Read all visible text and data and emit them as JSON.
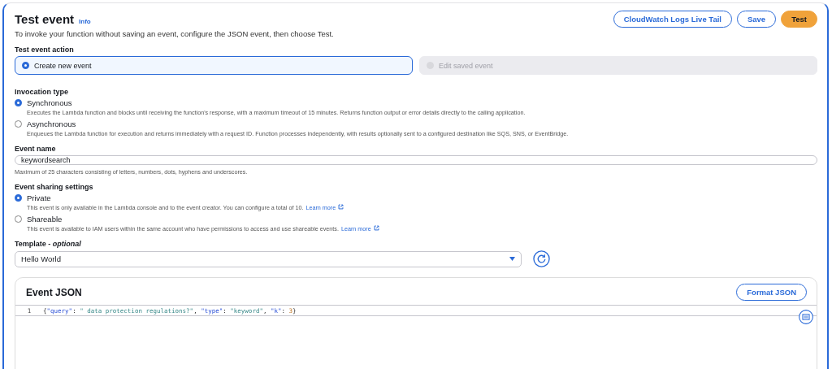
{
  "header": {
    "title": "Test event",
    "info_link": "Info",
    "description": "To invoke your function without saving an event, configure the JSON event, then choose Test.",
    "buttons": [
      {
        "label": "CloudWatch Logs Live Tail",
        "kind": "secondary"
      },
      {
        "label": "Save",
        "kind": "secondary"
      },
      {
        "label": "Test",
        "kind": "primary"
      }
    ]
  },
  "test_event_action": {
    "label": "Test event action",
    "options": [
      {
        "label": "Create new event",
        "selected": true,
        "disabled": false
      },
      {
        "label": "Edit saved event",
        "selected": false,
        "disabled": true
      }
    ]
  },
  "invocation_type": {
    "label": "Invocation type",
    "options": [
      {
        "label": "Synchronous",
        "selected": true,
        "description": "Executes the Lambda function and blocks until receiving the function's response, with a maximum timeout of 15 minutes. Returns function output or error details directly to the calling application."
      },
      {
        "label": "Asynchronous",
        "selected": false,
        "description": "Enqueues the Lambda function for execution and returns immediately with a request ID. Function processes independently, with results optionally sent to a configured destination like SQS, SNS, or EventBridge."
      }
    ]
  },
  "event_name": {
    "label": "Event name",
    "value": "keywordsearch",
    "hint": "Maximum of 25 characters consisting of letters, numbers, dots, hyphens and underscores."
  },
  "event_sharing": {
    "label": "Event sharing settings",
    "options": [
      {
        "label": "Private",
        "selected": true,
        "description": "This event is only available in the Lambda console and to the event creator. You can configure a total of 10.",
        "link": "Learn more"
      },
      {
        "label": "Shareable",
        "selected": false,
        "description": "This event is available to IAM users within the same account who have permissions to access and use shareable events.",
        "link": "Learn more"
      }
    ]
  },
  "template": {
    "label": "Template - ",
    "label_suffix": "optional",
    "value": "Hello World"
  },
  "event_json": {
    "title": "Event JSON",
    "button": "Format JSON",
    "lines": [
      {
        "number": "1",
        "tokens": [
          {
            "kind": "punct",
            "text": "{"
          },
          {
            "kind": "key",
            "text": "\"query\""
          },
          {
            "kind": "punct",
            "text": ": "
          },
          {
            "kind": "string",
            "text": "\" data protection regulations?\""
          },
          {
            "kind": "punct",
            "text": ", "
          },
          {
            "kind": "key",
            "text": "\"type\""
          },
          {
            "kind": "punct",
            "text": ": "
          },
          {
            "kind": "string",
            "text": "\"keyword\""
          },
          {
            "kind": "punct",
            "text": ", "
          },
          {
            "kind": "key",
            "text": "\"k\""
          },
          {
            "kind": "punct",
            "text": ": "
          },
          {
            "kind": "number",
            "text": "3"
          },
          {
            "kind": "punct",
            "text": "}"
          }
        ]
      }
    ]
  }
}
